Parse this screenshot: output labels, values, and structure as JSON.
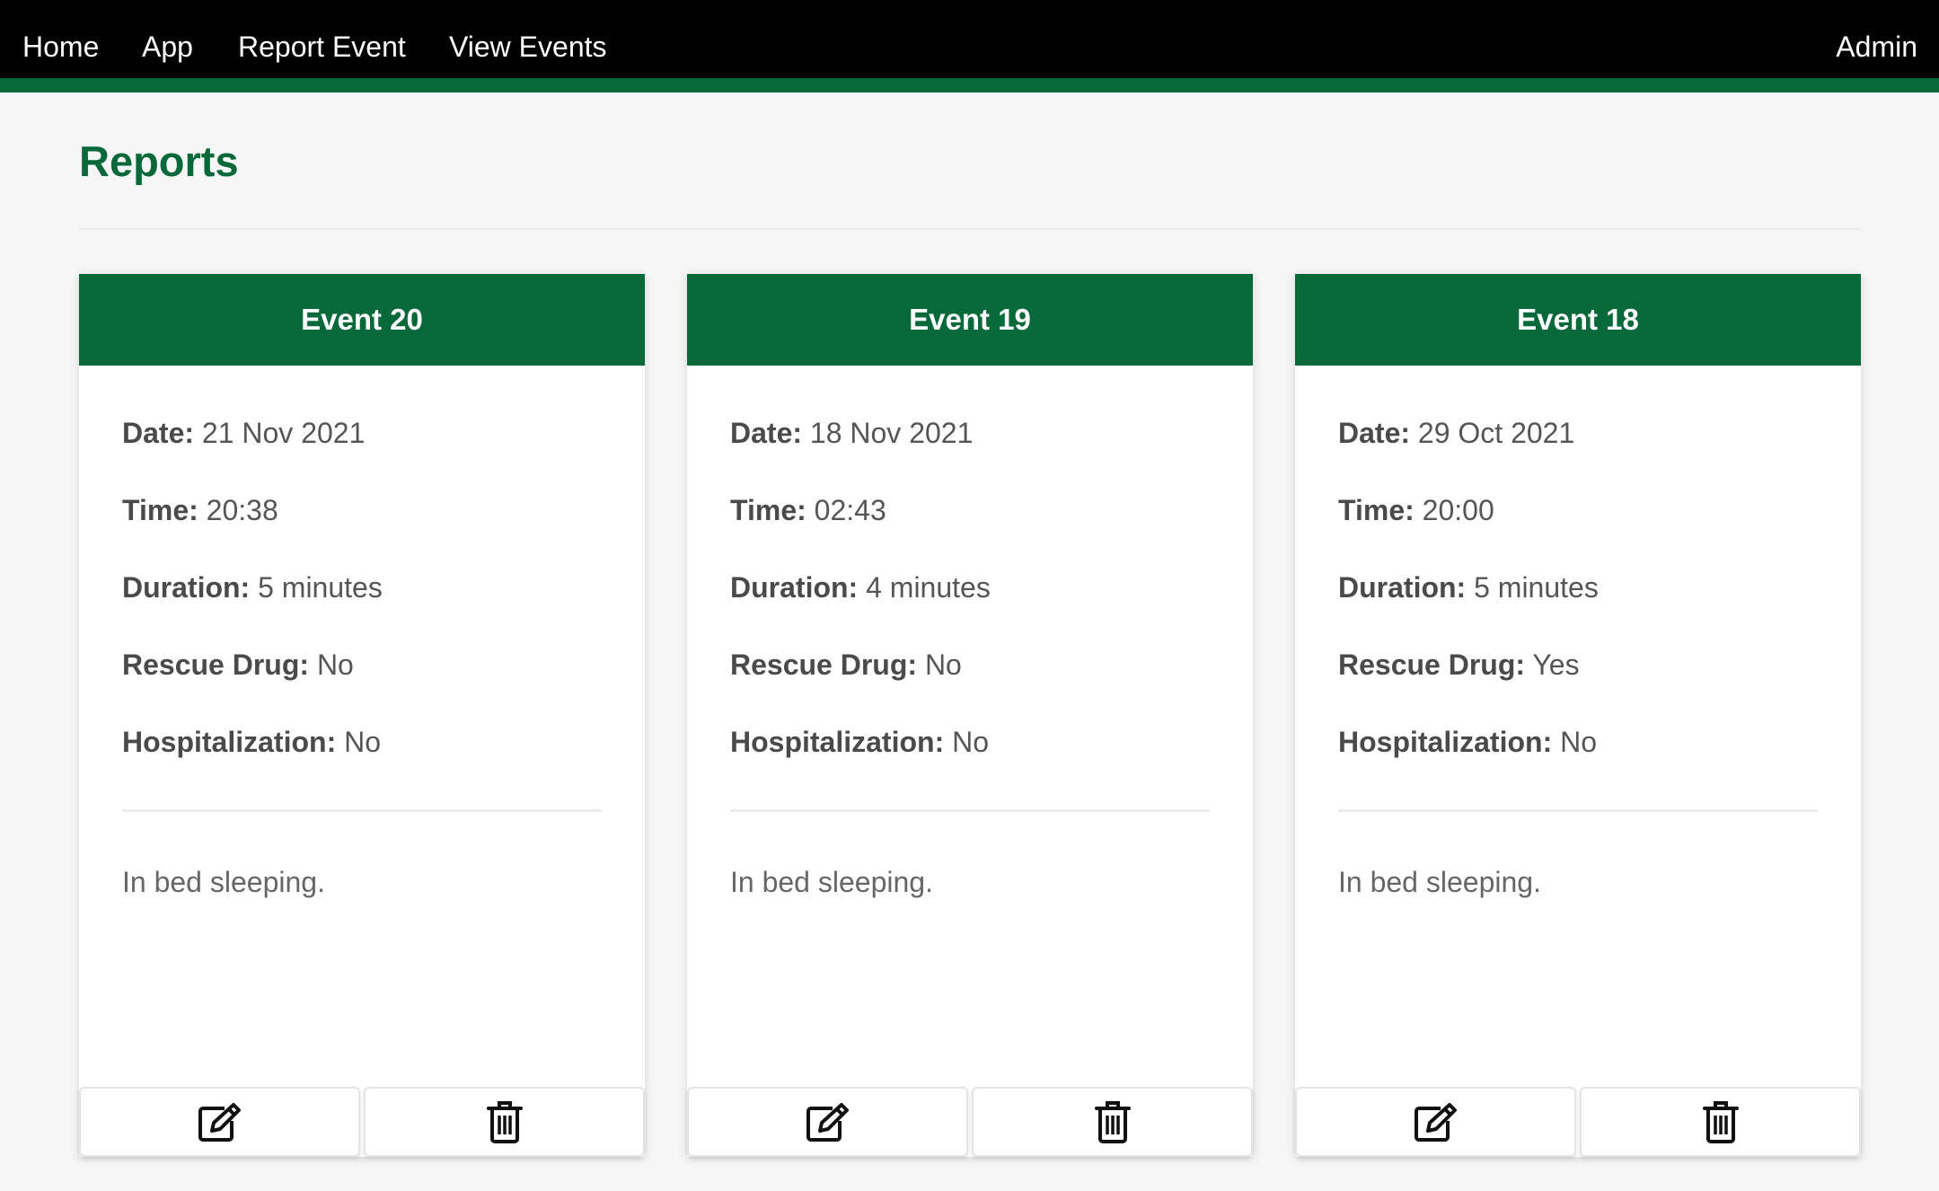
{
  "nav": {
    "home": "Home",
    "app": "App",
    "report_event": "Report Event",
    "view_events": "View Events",
    "admin": "Admin"
  },
  "page": {
    "title": "Reports"
  },
  "colors": {
    "brand_green": "#07693a",
    "navbar_bg": "#000000",
    "page_bg": "#f6f6f6"
  },
  "icons": {
    "edit": "edit-icon",
    "delete": "trash-icon"
  },
  "cards": [
    {
      "title": "Event 20",
      "date_label": "Date:",
      "date": "21 Nov 2021",
      "time_label": "Time:",
      "time": "20:38",
      "duration_label": "Duration:",
      "duration": "5 minutes",
      "rescue_label": "Rescue Drug:",
      "rescue": "No",
      "hosp_label": "Hospitalization:",
      "hosp": "No",
      "note": "In bed sleeping."
    },
    {
      "title": "Event 19",
      "date_label": "Date:",
      "date": "18 Nov 2021",
      "time_label": "Time:",
      "time": "02:43",
      "duration_label": "Duration:",
      "duration": "4 minutes",
      "rescue_label": "Rescue Drug:",
      "rescue": "No",
      "hosp_label": "Hospitalization:",
      "hosp": "No",
      "note": "In bed sleeping."
    },
    {
      "title": "Event 18",
      "date_label": "Date:",
      "date": "29 Oct 2021",
      "time_label": "Time:",
      "time": "20:00",
      "duration_label": "Duration:",
      "duration": "5 minutes",
      "rescue_label": "Rescue Drug:",
      "rescue": "Yes",
      "hosp_label": "Hospitalization:",
      "hosp": "No",
      "note": "In bed sleeping."
    }
  ]
}
